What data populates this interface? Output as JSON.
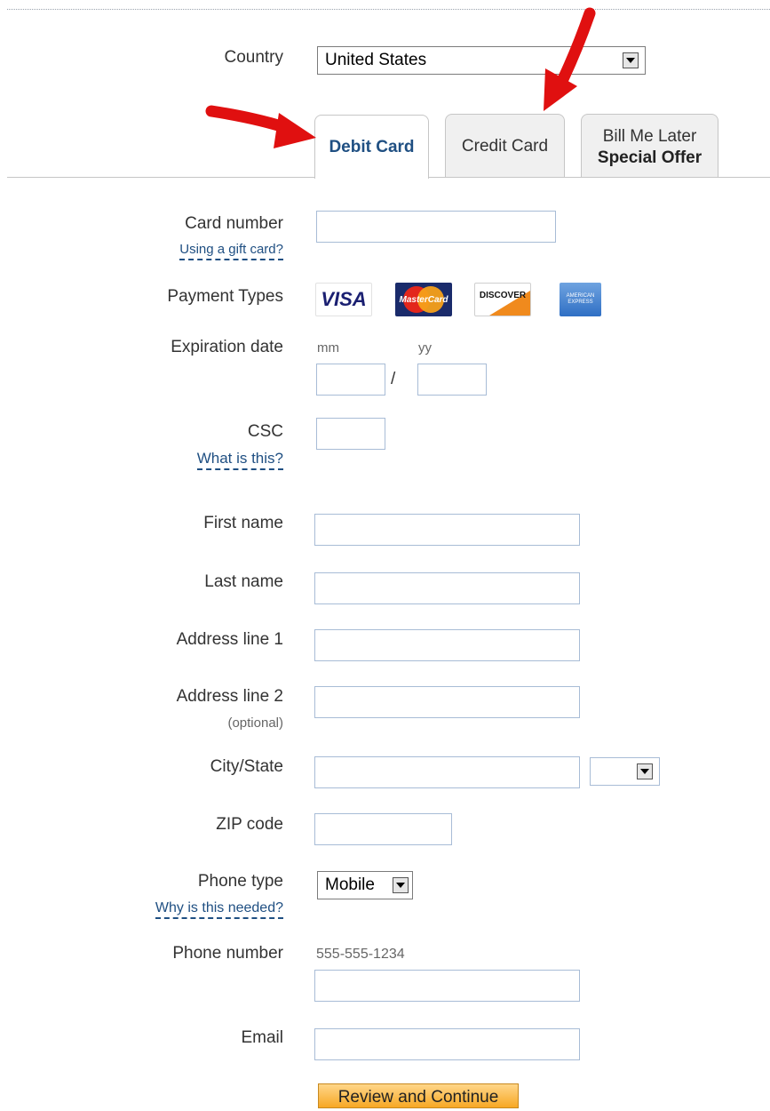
{
  "country": {
    "label": "Country",
    "selected": "United States"
  },
  "tabs": {
    "debit": "Debit Card",
    "credit": "Credit Card",
    "bml_line1": "Bill Me Later",
    "bml_line2": "Special Offer"
  },
  "card_number": {
    "label": "Card number",
    "help": "Using a gift card?",
    "value": ""
  },
  "payment_types": {
    "label": "Payment Types",
    "visa": "VISA",
    "mastercard": "MasterCard",
    "discover": "DISCOVER",
    "amex": "AMERICAN EXPRESS"
  },
  "expiration": {
    "label": "Expiration date",
    "mm": "mm",
    "yy": "yy",
    "separator": "/"
  },
  "csc": {
    "label": "CSC",
    "help": "What is this?"
  },
  "first_name": {
    "label": "First name"
  },
  "last_name": {
    "label": "Last name"
  },
  "address1": {
    "label": "Address line 1"
  },
  "address2": {
    "label": "Address line 2",
    "note": "(optional)"
  },
  "city_state": {
    "label": "City/State",
    "state_selected": ""
  },
  "zip": {
    "label": "ZIP code"
  },
  "phone_type": {
    "label": "Phone type",
    "help": "Why is this needed?",
    "selected": "Mobile"
  },
  "phone_number": {
    "label": "Phone number",
    "hint": "555-555-1234"
  },
  "email": {
    "label": "Email"
  },
  "submit": {
    "label": "Review and Continue"
  },
  "colors": {
    "link": "#1f4f82",
    "arrow": "#e01010",
    "button": "#f7a824"
  }
}
